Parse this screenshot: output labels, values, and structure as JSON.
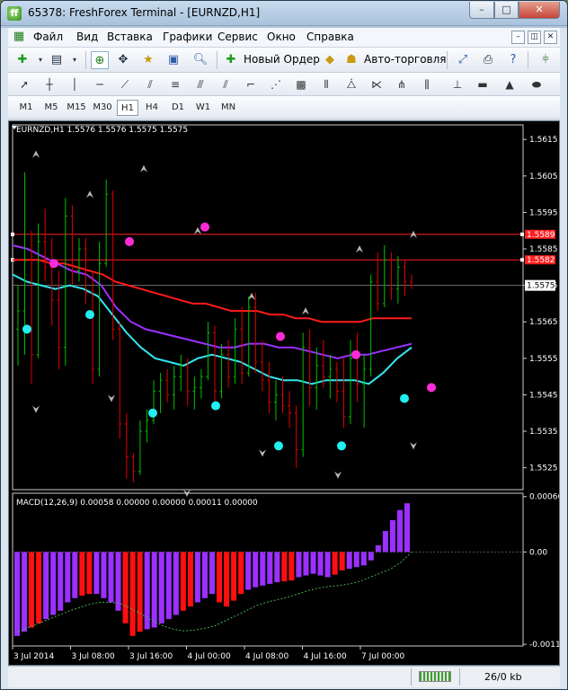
{
  "window": {
    "title": "65378: FreshForex Terminal - [EURNZD,H1]",
    "app_icon": "ff",
    "minimize": "–",
    "maximize": "□",
    "close": "✕"
  },
  "menu": [
    "Файл",
    "Вид",
    "Вставка",
    "Графики",
    "Сервис",
    "Окно",
    "Справка"
  ],
  "mdi_controls": [
    "–",
    "◫",
    "✕"
  ],
  "toolbar": {
    "new_order": "Новый Ордер",
    "auto_trading": "Авто-торговля"
  },
  "timeframes": [
    "M1",
    "M5",
    "M15",
    "M30",
    "H1",
    "H4",
    "D1",
    "W1",
    "MN"
  ],
  "active_timeframe": "H1",
  "chart": {
    "header": "EURNZD,H1  1.5576 1.5576 1.5575 1.5575",
    "price_axis": [
      "1.5615",
      "1.5605",
      "1.5595",
      "1.5585",
      "1.5575",
      "1.5565",
      "1.5555",
      "1.5545",
      "1.5535",
      "1.5525"
    ],
    "price_min": 1.5519,
    "price_max": 1.5619,
    "line_tags": [
      {
        "price": 1.5589,
        "label": "1.5589"
      },
      {
        "price": 1.5582,
        "label": "1.5582"
      }
    ],
    "current_price": {
      "price": 1.5575,
      "label": "1.5575"
    },
    "macd_header": "MACD(12,26,9) 0.00058 0.00000 0.00000 0.00011 0.00000",
    "macd_axis": [
      "0.00066",
      "0.00",
      "-0.0011"
    ],
    "macd_min": -0.00112,
    "macd_max": 0.0007,
    "time_axis": [
      "3 Jul 2014",
      "3 Jul 08:00",
      "3 Jul 16:00",
      "4 Jul 00:00",
      "4 Jul 08:00",
      "4 Jul 16:00",
      "7 Jul 00:00"
    ],
    "colors": {
      "up": "#00c000",
      "down": "#e00000",
      "ma_red": "#ff1a1a",
      "ma_violet": "#9b30ff",
      "ma_cyan": "#33e6f0",
      "macd_pos": "#9b30ff",
      "macd_neg": "#ff1010",
      "signal": "#4caf50",
      "dot_cyan": "#20f0f0",
      "dot_magenta": "#ff2bd6"
    }
  },
  "chart_data": {
    "type": "candlestick",
    "x": [
      "3 Jul 2014",
      "3 Jul 08:00",
      "3 Jul 16:00",
      "4 Jul 00:00",
      "4 Jul 08:00",
      "4 Jul 16:00",
      "7 Jul 00:00"
    ],
    "candles": [
      [
        1.5563,
        1.5575,
        1.5553,
        1.5568
      ],
      [
        1.5568,
        1.5606,
        1.5556,
        1.5582
      ],
      [
        1.5582,
        1.559,
        1.5548,
        1.5556
      ],
      [
        1.5556,
        1.5592,
        1.5555,
        1.5587
      ],
      [
        1.5587,
        1.5596,
        1.5576,
        1.558
      ],
      [
        1.558,
        1.5588,
        1.5564,
        1.5571
      ],
      [
        1.5571,
        1.5579,
        1.5552,
        1.5558
      ],
      [
        1.5558,
        1.5599,
        1.5553,
        1.5594
      ],
      [
        1.5594,
        1.5597,
        1.5575,
        1.5579
      ],
      [
        1.5579,
        1.5588,
        1.5576,
        1.5585
      ],
      [
        1.5585,
        1.5588,
        1.557,
        1.5573
      ],
      [
        1.5573,
        1.5579,
        1.5548,
        1.5552
      ],
      [
        1.5552,
        1.5587,
        1.555,
        1.5581
      ],
      [
        1.5581,
        1.5604,
        1.558,
        1.56
      ],
      [
        1.56,
        1.5601,
        1.556,
        1.5563
      ],
      [
        1.5563,
        1.5565,
        1.5533,
        1.5537
      ],
      [
        1.5537,
        1.554,
        1.5522,
        1.5528
      ],
      [
        1.5528,
        1.5529,
        1.5521,
        1.5524
      ],
      [
        1.5524,
        1.5538,
        1.5523,
        1.5535
      ],
      [
        1.5535,
        1.5541,
        1.5532,
        1.5538
      ],
      [
        1.5538,
        1.5549,
        1.5537,
        1.5546
      ],
      [
        1.5546,
        1.5551,
        1.554,
        1.5549
      ],
      [
        1.5549,
        1.5552,
        1.5543,
        1.5545
      ],
      [
        1.5545,
        1.5553,
        1.5541,
        1.555
      ],
      [
        1.555,
        1.5556,
        1.5546,
        1.5553
      ],
      [
        1.5553,
        1.5555,
        1.5542,
        1.5546
      ],
      [
        1.5546,
        1.555,
        1.5541,
        1.5547
      ],
      [
        1.5547,
        1.5552,
        1.5544,
        1.555
      ],
      [
        1.555,
        1.5565,
        1.5549,
        1.5562
      ],
      [
        1.5562,
        1.5564,
        1.5543,
        1.5546
      ],
      [
        1.5546,
        1.5559,
        1.5544,
        1.5556
      ],
      [
        1.5556,
        1.556,
        1.5547,
        1.555
      ],
      [
        1.555,
        1.5566,
        1.5548,
        1.5563
      ],
      [
        1.5563,
        1.5569,
        1.5548,
        1.5551
      ],
      [
        1.5551,
        1.5572,
        1.555,
        1.5569
      ],
      [
        1.5569,
        1.5573,
        1.5551,
        1.5554
      ],
      [
        1.5554,
        1.556,
        1.5546,
        1.5549
      ],
      [
        1.5549,
        1.5554,
        1.554,
        1.5543
      ],
      [
        1.5543,
        1.5549,
        1.5538,
        1.5545
      ],
      [
        1.5545,
        1.555,
        1.554,
        1.5542
      ],
      [
        1.5542,
        1.5546,
        1.5536,
        1.554
      ],
      [
        1.554,
        1.5542,
        1.5525,
        1.553
      ],
      [
        1.553,
        1.5562,
        1.5528,
        1.5558
      ],
      [
        1.5558,
        1.5563,
        1.5542,
        1.5547
      ],
      [
        1.5547,
        1.5558,
        1.5541,
        1.5553
      ],
      [
        1.5553,
        1.556,
        1.5547,
        1.555
      ],
      [
        1.555,
        1.5556,
        1.5544,
        1.5552
      ],
      [
        1.5552,
        1.5554,
        1.5543,
        1.5546
      ],
      [
        1.5546,
        1.5555,
        1.5536,
        1.5539
      ],
      [
        1.5539,
        1.556,
        1.5537,
        1.5555
      ],
      [
        1.5555,
        1.5562,
        1.5543,
        1.5548
      ],
      [
        1.5548,
        1.5556,
        1.5536,
        1.5552
      ],
      [
        1.5552,
        1.5578,
        1.555,
        1.5576
      ],
      [
        1.5576,
        1.5584,
        1.5568,
        1.557
      ],
      [
        1.557,
        1.5586,
        1.5569,
        1.5582
      ],
      [
        1.5582,
        1.5584,
        1.5571,
        1.5574
      ],
      [
        1.5574,
        1.5583,
        1.557,
        1.558
      ],
      [
        1.558,
        1.5582,
        1.5572,
        1.5576
      ],
      [
        1.5576,
        1.5578,
        1.5574,
        1.5575
      ]
    ],
    "ma_red": [
      1.5582,
      1.5582,
      1.5582,
      1.5581,
      1.5581,
      1.558,
      1.5579,
      1.5578,
      1.5576,
      1.5575,
      1.5574,
      1.5573,
      1.5572,
      1.5571,
      1.557,
      1.557,
      1.5569,
      1.5568,
      1.5568,
      1.5568,
      1.5567,
      1.5567,
      1.5566,
      1.5566,
      1.5565,
      1.5565,
      1.5565,
      1.5565,
      1.5566,
      1.5566,
      1.5566,
      1.5566
    ],
    "ma_violet": [
      1.5586,
      1.5585,
      1.5583,
      1.5581,
      1.5579,
      1.5578,
      1.5575,
      1.5569,
      1.5565,
      1.5563,
      1.5562,
      1.5561,
      1.556,
      1.5559,
      1.5558,
      1.5558,
      1.5559,
      1.5559,
      1.5558,
      1.5558,
      1.5557,
      1.5556,
      1.5555,
      1.5556,
      1.5556,
      1.5557,
      1.5558,
      1.5559
    ],
    "ma_cyan": [
      1.5578,
      1.5576,
      1.5575,
      1.5574,
      1.5575,
      1.5574,
      1.5572,
      1.5567,
      1.5562,
      1.5558,
      1.5555,
      1.5554,
      1.5553,
      1.5555,
      1.5556,
      1.5555,
      1.5554,
      1.5552,
      1.555,
      1.5549,
      1.5549,
      1.5548,
      1.5549,
      1.5549,
      1.5549,
      1.5548,
      1.5551,
      1.5555,
      1.5558
    ],
    "fractals_up": [
      1.561,
      1.5599,
      1.5606,
      1.5589,
      1.5571,
      1.5567,
      1.5584,
      1.5588
    ],
    "fractals_down": [
      1.5542,
      1.5545,
      1.5519,
      1.553,
      1.5524,
      1.5532
    ],
    "dots_cyan": [
      1.5563,
      1.5567,
      1.554,
      1.5542,
      1.5531,
      1.5531,
      1.5544
    ],
    "dots_magenta": [
      1.5581,
      1.5587,
      1.5591,
      1.5561,
      1.5556,
      1.5547
    ],
    "macd_hist": [
      -0.001,
      -0.00095,
      -0.0009,
      -0.00085,
      -0.0008,
      -0.00075,
      -0.0007,
      -0.0006,
      -0.00055,
      -0.00052,
      -0.0005,
      -0.0005,
      -0.00055,
      -0.0006,
      -0.0007,
      -0.00085,
      -0.001,
      -0.00095,
      -0.00092,
      -0.0009,
      -0.00085,
      -0.0008,
      -0.00075,
      -0.0007,
      -0.00065,
      -0.0006,
      -0.00055,
      -0.0005,
      -0.0006,
      -0.00065,
      -0.00058,
      -0.0005,
      -0.00045,
      -0.00042,
      -0.0004,
      -0.00038,
      -0.00036,
      -0.00035,
      -0.00034,
      -0.0003,
      -0.00028,
      -0.00026,
      -0.00028,
      -0.0003,
      -0.00027,
      -0.00022,
      -0.0002,
      -0.00018,
      -0.00016,
      -0.0001,
      8e-05,
      0.00025,
      0.00038,
      0.0005,
      0.00058
    ],
    "macd_signal": [
      -0.00095,
      -0.0009,
      -0.00085,
      -0.0008,
      -0.00075,
      -0.0007,
      -0.00066,
      -0.00062,
      -0.0006,
      -0.0006,
      -0.00062,
      -0.00068,
      -0.00075,
      -0.00082,
      -0.00088,
      -0.00092,
      -0.00094,
      -0.00093,
      -0.00091,
      -0.00088,
      -0.00082,
      -0.00076,
      -0.0007,
      -0.00064,
      -0.0006,
      -0.00057,
      -0.00054,
      -0.0005,
      -0.00046,
      -0.00043,
      -0.00041,
      -0.0004,
      -0.00038,
      -0.00035,
      -0.0003,
      -0.00025,
      -0.0002,
      -0.00012,
      0.0
    ]
  },
  "status": {
    "traffic": "||||",
    "kb": "26/0 kb"
  }
}
